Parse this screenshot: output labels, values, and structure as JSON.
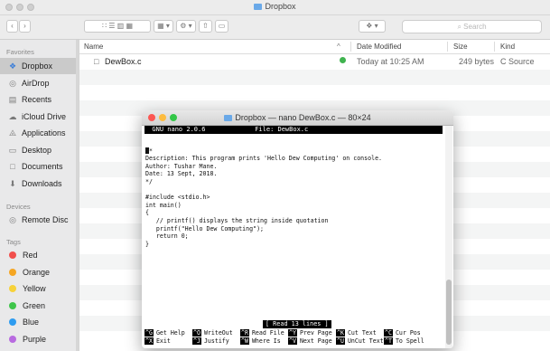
{
  "finder": {
    "title": "Dropbox",
    "search_placeholder": "Search",
    "toolbar": {
      "view_icons": "∷ ☰ ▥ ▦",
      "arrange": "▦ ▾",
      "action": "⚙ ▾",
      "share": "⇧",
      "tags": "▭",
      "dropbox_menu": "❖ ▾"
    },
    "columns": {
      "name": "Name",
      "date": "Date Modified",
      "size": "Size",
      "kind": "Kind"
    },
    "files": [
      {
        "name": "DewBox.c",
        "date": "Today at 10:25 AM",
        "size": "249 bytes",
        "kind": "C Source"
      }
    ],
    "sidebar": {
      "favorites_header": "Favorites",
      "favorites": [
        {
          "label": "Dropbox",
          "icon": "dropbox-icon",
          "glyph": "❖"
        },
        {
          "label": "AirDrop",
          "icon": "airdrop-icon",
          "glyph": "◎"
        },
        {
          "label": "Recents",
          "icon": "recents-icon",
          "glyph": "▤"
        },
        {
          "label": "iCloud Drive",
          "icon": "cloud-icon",
          "glyph": "☁"
        },
        {
          "label": "Applications",
          "icon": "applications-icon",
          "glyph": "⨻"
        },
        {
          "label": "Desktop",
          "icon": "desktop-icon",
          "glyph": "▭"
        },
        {
          "label": "Documents",
          "icon": "documents-icon",
          "glyph": "□"
        },
        {
          "label": "Downloads",
          "icon": "downloads-icon",
          "glyph": "⬇"
        }
      ],
      "devices_header": "Devices",
      "devices": [
        {
          "label": "Remote Disc",
          "icon": "disc-icon",
          "glyph": "◎"
        }
      ],
      "tags_header": "Tags",
      "tags": [
        {
          "label": "Red",
          "color": "#f14f4c"
        },
        {
          "label": "Orange",
          "color": "#f5a623"
        },
        {
          "label": "Yellow",
          "color": "#f7d23a"
        },
        {
          "label": "Green",
          "color": "#3fc54a"
        },
        {
          "label": "Blue",
          "color": "#2e9cf0"
        },
        {
          "label": "Purple",
          "color": "#b86be0"
        }
      ]
    }
  },
  "terminal": {
    "title": "Dropbox — nano DewBox.c — 80×24",
    "nano_bar": "  GNU nano 2.0.6             File: DewBox.c",
    "code_lines": [
      "",
      "*",
      "Description: This program prints 'Hello Dew Computing' on console.",
      "Author: Tushar Mane.",
      "Date: 13 Sept, 2018.",
      "*/",
      "",
      "#include <stdio.h>",
      "int main()",
      "{",
      "   // printf() displays the string inside quotation",
      "   printf(\"Hello Dew Computing\");",
      "   return 0;",
      "}"
    ],
    "status_message": "[ Read 13 lines ]",
    "shortcuts": [
      {
        "key": "^G",
        "label": "Get Help"
      },
      {
        "key": "^O",
        "label": "WriteOut"
      },
      {
        "key": "^R",
        "label": "Read File"
      },
      {
        "key": "^Y",
        "label": "Prev Page"
      },
      {
        "key": "^K",
        "label": "Cut Text"
      },
      {
        "key": "^C",
        "label": "Cur Pos"
      },
      {
        "key": "^X",
        "label": "Exit"
      },
      {
        "key": "^J",
        "label": "Justify"
      },
      {
        "key": "^W",
        "label": "Where Is"
      },
      {
        "key": "^V",
        "label": "Next Page"
      },
      {
        "key": "^U",
        "label": "UnCut Text"
      },
      {
        "key": "^T",
        "label": "To Spell"
      }
    ],
    "colors": {
      "close": "#fc5753",
      "minimize": "#fdbc40",
      "zoom": "#33c748"
    }
  }
}
